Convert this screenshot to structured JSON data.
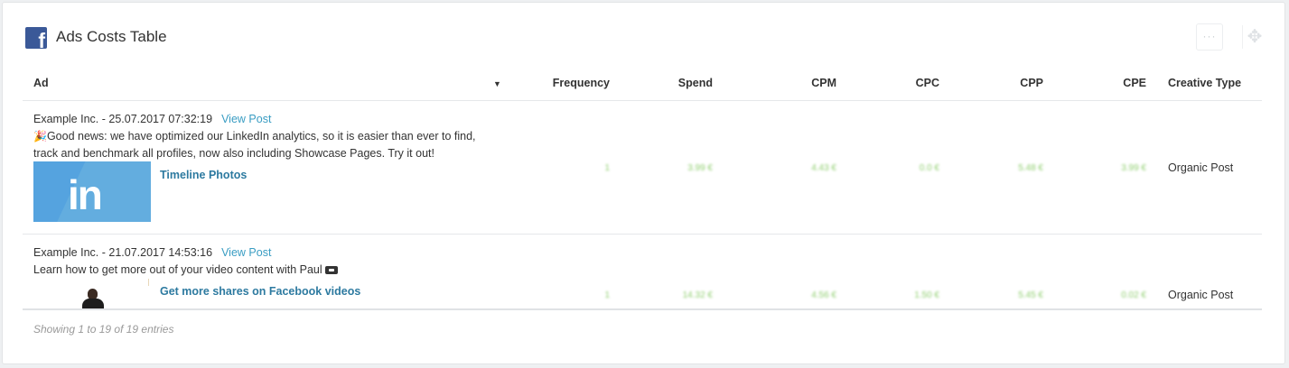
{
  "card": {
    "title": "Ads Costs Table",
    "menu_label": "···",
    "move_label": "✥"
  },
  "table": {
    "headers": {
      "ad": "Ad",
      "frequency": "Frequency",
      "spend": "Spend",
      "cpm": "CPM",
      "cpc": "CPC",
      "cpp": "CPP",
      "cpe": "CPE",
      "creative_type": "Creative Type"
    },
    "rows": [
      {
        "meta": "Example Inc. - 25.07.2017 07:32:19",
        "view_post": "View Post",
        "emoji": "🎉",
        "text": "Good news: we have optimized our LinkedIn analytics, so it is easier than ever to find, track and benchmark all profiles, now also including Showcase Pages. Try it out!",
        "thumb_text": "in",
        "link_title": "Timeline Photos",
        "frequency": "1",
        "spend": "3.99 €",
        "cpm": "4.43 €",
        "cpc": "0.0 €",
        "cpp": "5.48 €",
        "cpe": "3.99 €",
        "creative_type": "Organic Post"
      },
      {
        "meta": "Example Inc. - 21.07.2017 14:53:16",
        "view_post": "View Post",
        "text": "Learn how to get more out of your video content with Paul",
        "link_title": "Get more shares on Facebook videos",
        "frequency": "1",
        "spend": "14.32 €",
        "cpm": "4.56 €",
        "cpc": "1.50 €",
        "cpp": "5.45 €",
        "cpe": "0.02 €",
        "creative_type": "Organic Post"
      }
    ],
    "footer": "Showing 1 to 19 of 19 entries"
  },
  "colors": {
    "facebook": "#3b5998",
    "link": "#3a9dc3",
    "link_title": "#2d7aa0",
    "value_green": "#8fce6f",
    "linkedin": "#55a3df"
  }
}
